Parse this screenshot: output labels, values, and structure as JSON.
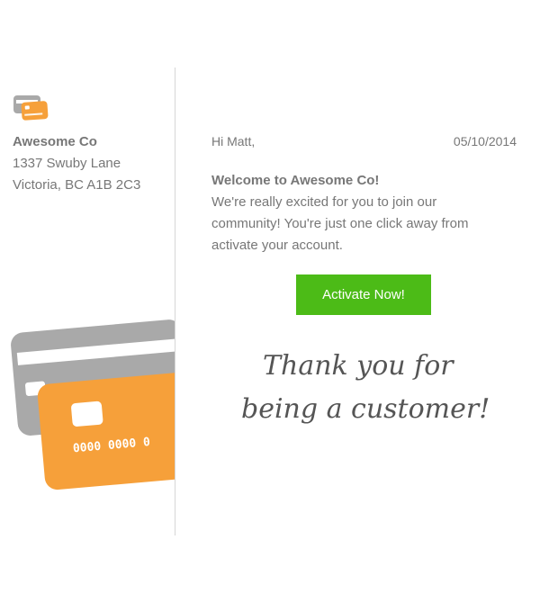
{
  "sender": {
    "company_name": "Awesome Co",
    "address_line1": "1337 Swuby Lane",
    "address_line2": "Victoria, BC A1B 2C3",
    "logo_icon": "credit-cards-icon"
  },
  "email": {
    "greeting": "Hi Matt,",
    "date": "05/10/2014",
    "welcome_title": "Welcome to Awesome Co!",
    "welcome_body": "We're really excited for you to join our community! You're just one click away from activate your account.",
    "activate_label": "Activate Now!",
    "signature_line1": "Thank you for",
    "signature_line2": "being a customer!"
  },
  "illustration": {
    "card_number": "0000 0000 0"
  },
  "colors": {
    "accent_orange": "#f6a03a",
    "card_gray": "#a9a9a9",
    "button_green": "#4cbb17",
    "text_gray": "#777777"
  }
}
